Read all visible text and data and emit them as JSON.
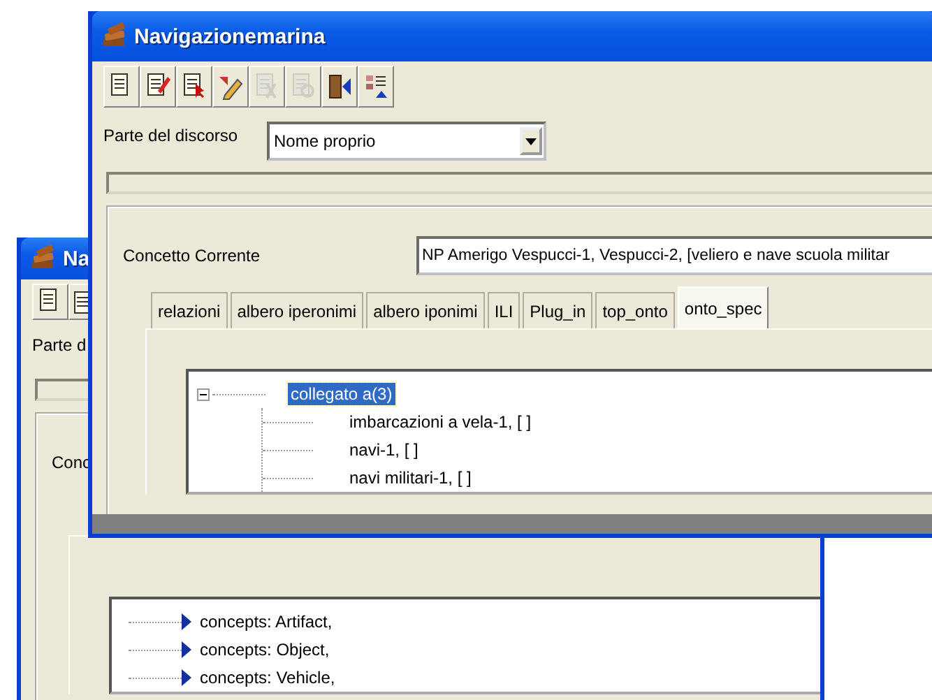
{
  "back_window": {
    "title": "Na",
    "toolbar": [
      {
        "disabled": false
      },
      {
        "disabled": false
      }
    ],
    "part_of_speech": {
      "label": "Parte d"
    },
    "concept": {
      "label": "Conc"
    },
    "tree": [
      {
        "kind": "concept",
        "label": "concepts:  Artifact,",
        "selected": false
      },
      {
        "kind": "concept",
        "label": "concepts:  Object,",
        "selected": false
      },
      {
        "kind": "concept",
        "label": "concepts:  Vehicle,",
        "selected": false
      }
    ]
  },
  "front_window": {
    "title": "Navigazionemarina",
    "toolbar": [
      {
        "disabled": false
      },
      {
        "disabled": false
      },
      {
        "disabled": false
      },
      {
        "disabled": false
      },
      {
        "disabled": true
      },
      {
        "disabled": true
      },
      {
        "disabled": false
      },
      {
        "disabled": false
      }
    ],
    "part_of_speech": {
      "label": "Parte del discorso",
      "value": "Nome proprio"
    },
    "concept": {
      "label": "Concetto Corrente",
      "value": "NP Amerigo Vespucci-1, Vespucci-2,  [veliero e nave scuola militar"
    },
    "tabs": [
      {
        "label": "relazioni",
        "selected": false
      },
      {
        "label": "albero iperonimi",
        "selected": false
      },
      {
        "label": "albero iponimi",
        "selected": false
      },
      {
        "label": "ILI",
        "selected": false
      },
      {
        "label": "Plug_in",
        "selected": false
      },
      {
        "label": "top_onto",
        "selected": false
      },
      {
        "label": "onto_spec",
        "selected": true
      }
    ],
    "tree": [
      {
        "kind": "relation",
        "label": "collegato a(3)",
        "selected": true,
        "expanded": true,
        "children": [
          {
            "kind": "entry",
            "label": "imbarcazioni a vela-1,  [ ]",
            "selected": false
          },
          {
            "kind": "entry",
            "label": "navi-1,  [ ]",
            "selected": false
          },
          {
            "kind": "entry",
            "label": "navi militari-1,  [ ]",
            "selected": false
          }
        ]
      }
    ]
  }
}
